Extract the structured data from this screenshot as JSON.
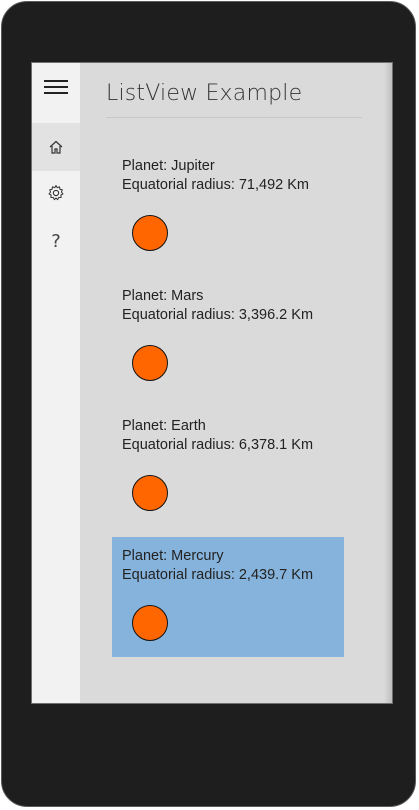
{
  "page": {
    "title": "ListView Example"
  },
  "nav": {
    "items": [
      {
        "icon": "hamburger-menu-icon"
      },
      {
        "icon": "home-icon",
        "selected": true
      },
      {
        "icon": "gear-icon"
      },
      {
        "icon": "help-icon",
        "glyph": "?"
      }
    ]
  },
  "colors": {
    "planet_fill": "#ff6600",
    "selection_background": "#86b3db"
  },
  "planets": [
    {
      "planet_text": "Planet: Jupiter",
      "radius_text": "Equatorial radius: 71,492 Km",
      "selected": false
    },
    {
      "planet_text": "Planet: Mars",
      "radius_text": "Equatorial radius: 3,396.2 Km",
      "selected": false
    },
    {
      "planet_text": "Planet: Earth",
      "radius_text": "Equatorial radius: 6,378.1 Km",
      "selected": false
    },
    {
      "planet_text": "Planet: Mercury",
      "radius_text": "Equatorial radius: 2,439.7 Km",
      "selected": true
    }
  ]
}
